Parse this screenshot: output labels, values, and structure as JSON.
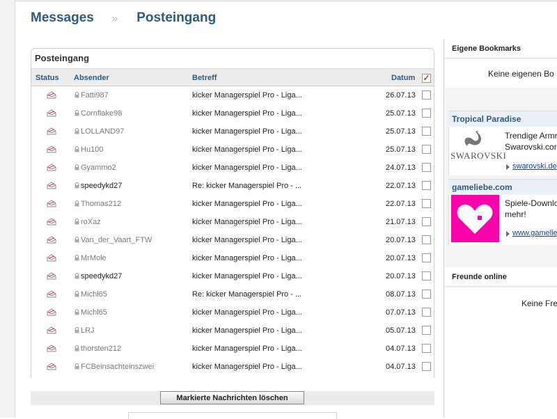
{
  "breadcrumb": {
    "first": "Messages",
    "separator": "»",
    "current": "Posteingang"
  },
  "inbox": {
    "title": "Posteingang",
    "columns": {
      "status": "Status",
      "sender": "Absender",
      "subject": "Betreff",
      "date": "Datum"
    },
    "select_all_checked": true,
    "rows": [
      {
        "sender": "Fatti987",
        "subject": "kicker Managerspiel Pro - Liga...",
        "date": "26.07.13",
        "read": true
      },
      {
        "sender": "Cornflake98",
        "subject": "kicker Managerspiel Pro - Liga...",
        "date": "25.07.13",
        "read": true
      },
      {
        "sender": "LOLLAND97",
        "subject": "kicker Managerspiel Pro - Liga...",
        "date": "25.07.13",
        "read": true
      },
      {
        "sender": "Hu100",
        "subject": "kicker Managerspiel Pro - Liga...",
        "date": "25.07.13",
        "read": true
      },
      {
        "sender": "Gyammo2",
        "subject": "kicker Managerspiel Pro - Liga...",
        "date": "24.07.13",
        "read": true
      },
      {
        "sender": "speedykd27",
        "subject": "Re: kicker Managerspiel Pro - ...",
        "date": "22.07.13",
        "read": false
      },
      {
        "sender": "Thomas212",
        "subject": "kicker Managerspiel Pro - Liga...",
        "date": "22.07.13",
        "read": true
      },
      {
        "sender": "roXaz",
        "subject": "kicker Managerspiel Pro - Liga...",
        "date": "21.07.13",
        "read": true
      },
      {
        "sender": "Van_der_Vaart_FTW",
        "subject": "kicker Managerspiel Pro - Liga...",
        "date": "20.07.13",
        "read": true
      },
      {
        "sender": "MrMole",
        "subject": "kicker Managerspiel Pro - Liga...",
        "date": "20.07.13",
        "read": true
      },
      {
        "sender": "speedykd27",
        "subject": "kicker Managerspiel Pro - Liga...",
        "date": "20.07.13",
        "read": false
      },
      {
        "sender": "Michl65",
        "subject": "Re: kicker Managerspiel Pro - ...",
        "date": "08.07.13",
        "read": true
      },
      {
        "sender": "Michl65",
        "subject": "kicker Managerspiel Pro - Liga...",
        "date": "07.07.13",
        "read": true
      },
      {
        "sender": "LRJ",
        "subject": "kicker Managerspiel Pro - Liga...",
        "date": "05.07.13",
        "read": true
      },
      {
        "sender": "thorsten212",
        "subject": "kicker Managerspiel Pro - Liga...",
        "date": "04.07.13",
        "read": true
      },
      {
        "sender": "FCBeinsachteinszwei",
        "subject": "kicker Managerspiel Pro - Liga...",
        "date": "04.07.13",
        "read": true
      }
    ]
  },
  "actions": {
    "delete_label": "Markierte Nachrichten löschen"
  },
  "sidebar": {
    "bookmarks": {
      "title": "Eigene Bookmarks",
      "empty_text": "Keine eigenen Bo"
    },
    "ads": [
      {
        "title": "Tropical Paradise",
        "logo_text": "SWAROVSKI",
        "text_line1": "Trendige Armr",
        "text_line2": "Swarovski.cor",
        "link": "swarovski.de"
      },
      {
        "title": "gameliebe.com",
        "text_line1": "Spiele-Downlo",
        "text_line2": "mehr!",
        "link": "www.gamelie"
      }
    ],
    "friends": {
      "title": "Freunde online",
      "empty_text": "Keine Fre"
    }
  },
  "colors": {
    "accent": "#2f5a7e",
    "ad_header_bg": "#eaf0f6",
    "gameliebe_pink": "#ff00aa",
    "link": "#1a3fa8",
    "checkmark": "#c0392b"
  }
}
